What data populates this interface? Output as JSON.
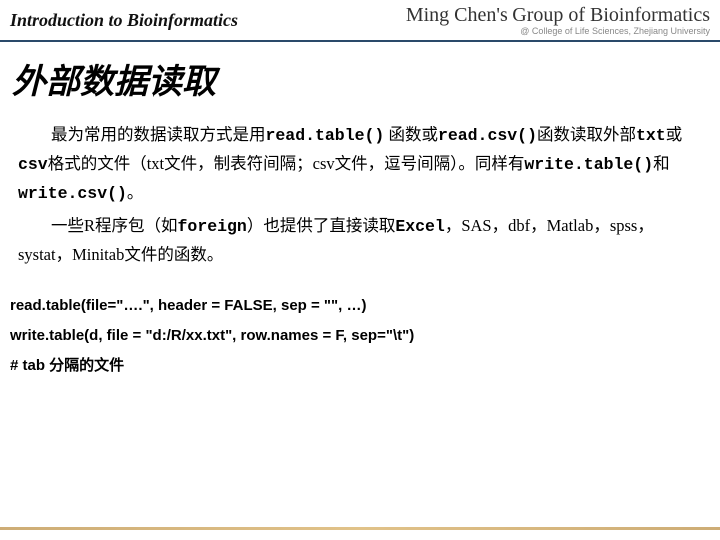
{
  "header": {
    "title": "Introduction to Bioinformatics",
    "brand_script": "Ming Chen's",
    "brand_rest": "Group of Bioinformatics",
    "subbrand": "@ College of Life Sciences, Zhejiang University"
  },
  "title": "外部数据读取",
  "para1": {
    "t0": "最为常用的数据读取方式是用",
    "c0": "read.table()",
    "t1": " 函数或",
    "c1": "read.csv()",
    "t2": "函数读取外部",
    "c2": "txt",
    "t3": "或",
    "c3": "csv",
    "t4": "格式的文件（txt文件，制表符间隔；csv文件，逗号间隔）。同样有",
    "c4": "write.table()",
    "t5": "和",
    "c5": "write.csv()",
    "t6": "。"
  },
  "para2": {
    "t0": "一些R程序包（如",
    "c0": "foreign",
    "t1": "）也提供了直接读取",
    "c1": "Excel",
    "t2": "，SAS，dbf，Matlab，spss， systat，Minitab文件的函数。"
  },
  "code": {
    "line1": "read.table(file=\"….\", header = FALSE, sep = \"\", …)",
    "line2": "write.table(d, file = \"d:/R/xx.txt\", row.names = F, sep=\"\\t\")",
    "line3": "# tab 分隔的文件"
  }
}
